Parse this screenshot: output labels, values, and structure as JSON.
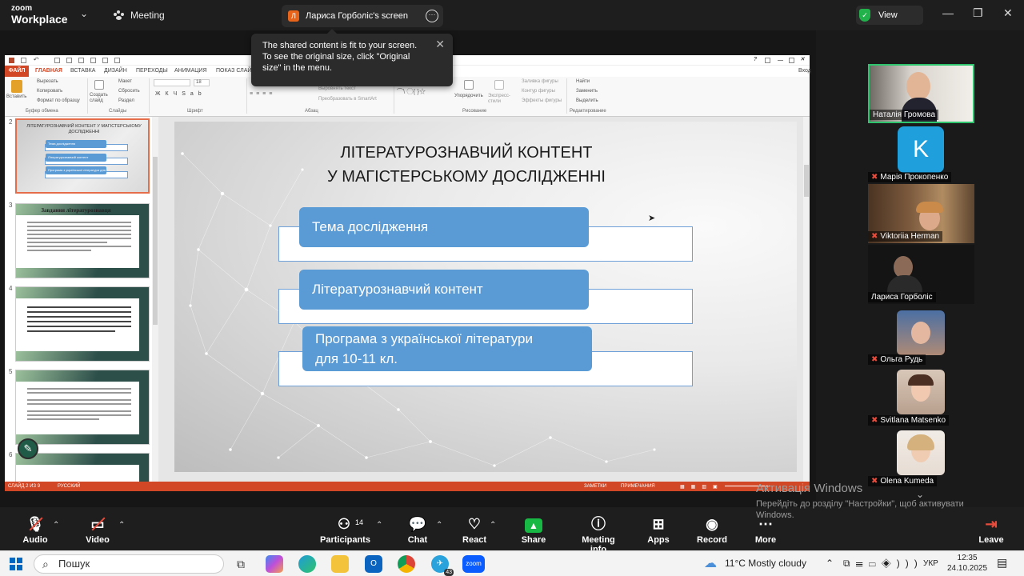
{
  "zoom": {
    "logo_top": "zoom",
    "logo_bottom": "Workplace",
    "meeting_label": "Meeting",
    "share_tab_initial": "Л",
    "share_tab_label": "Лариса Горболіс's screen",
    "view_label": "View",
    "tooltip_text": "The shared content is fit to your screen. To see the original size, click \"Original size\" in the menu.",
    "colors": {
      "accent_green": "#18b845",
      "ppt_orange": "#d24726"
    }
  },
  "ppt": {
    "tabs": [
      "ФАЙЛ",
      "ГЛАВНАЯ",
      "ВСТАВКА",
      "ДИЗАЙН",
      "ПЕРЕХОДЫ",
      "АНИМАЦИЯ",
      "ПОКАЗ СЛАЙ"
    ],
    "tab_right": "Вход",
    "ribbon": {
      "paste": "Вставить",
      "cut": "Вырезать",
      "copy": "Копировать",
      "format": "Формат по образцу",
      "clipboard": "Буфер обмена",
      "new_slide": "Создать слайд",
      "layout": "Макет",
      "reset": "Сбросить",
      "section": "Раздел",
      "slides_group": "Слайды",
      "font_size": "18",
      "font_group": "Шрифт",
      "paragraph_group": "Абзац",
      "align_text": "Выровнять текст",
      "smartart": "Преобразовать в SmartArt",
      "arrange": "Упорядочить",
      "quick_styles": "Экспресс-стили",
      "shape_fill": "Заливка фигуры",
      "shape_outline": "Контур фигуры",
      "shape_effects": "Эффекты фигуры",
      "drawing_group": "Рисование",
      "find": "Найти",
      "replace": "Заменить",
      "select": "Выделить",
      "editing_group": "Редактирование"
    },
    "thumbnails": {
      "nums": [
        "2",
        "3",
        "4",
        "5",
        "6"
      ],
      "t2_title": "ЛІТЕРАТУРОЗНАВЧИЙ КОНТЕНТ У МАГІСТЕРСЬКОМУ ДОСЛІДЖЕННІ",
      "t2_items": [
        "Тема дослідження",
        "Літературознавчий контент",
        "Програма з української літератури для 10-11 кл."
      ],
      "t3_title": "Завдання літературознавця"
    },
    "slide": {
      "title_line1": "ЛІТЕРАТУРОЗНАВЧИЙ КОНТЕНТ",
      "title_line2": "У МАГІСТЕРСЬКОМУ ДОСЛІДЖЕННІ",
      "item1": "Тема дослідження",
      "item2": "Літературознавчий контент",
      "item3_line1": "Програма з української літератури",
      "item3_line2": "для 10-11 кл."
    },
    "status": {
      "slide_of": "СЛАЙД 2 ИЗ 9",
      "language": "РУССКИЙ",
      "notes": "ЗАМЕТКИ",
      "comments": "ПРИМЕЧАНИЯ"
    }
  },
  "participants": [
    {
      "name": "Наталія Громова",
      "muted": false,
      "speaking": true
    },
    {
      "name": "Марія Прокопенко",
      "muted": true,
      "avatar_letter": "K"
    },
    {
      "name": "Viktoriia Herman",
      "muted": true
    },
    {
      "name": "Лариса Горболіс",
      "muted": false
    },
    {
      "name": "Ольга Рудь",
      "muted": true
    },
    {
      "name": "Svitlana Matsenko",
      "muted": true
    },
    {
      "name": "Olena Kumeda",
      "muted": true
    }
  ],
  "windows_activation": {
    "title": "Активація Windows",
    "text": "Перейдіть до розділу \"Настройки\", щоб активувати Windows."
  },
  "toolbar": {
    "audio": "Audio",
    "video": "Video",
    "participants": "Participants",
    "participants_count": "14",
    "chat": "Chat",
    "react": "React",
    "share": "Share",
    "meeting_info": "Meeting info",
    "apps": "Apps",
    "record": "Record",
    "more": "More",
    "leave": "Leave"
  },
  "taskbar": {
    "search_placeholder": "Пошук",
    "weather": "11°C  Mostly cloudy",
    "language": "УКР",
    "time": "12:35",
    "date": "24.10.2025",
    "telegram_badge": "43"
  }
}
